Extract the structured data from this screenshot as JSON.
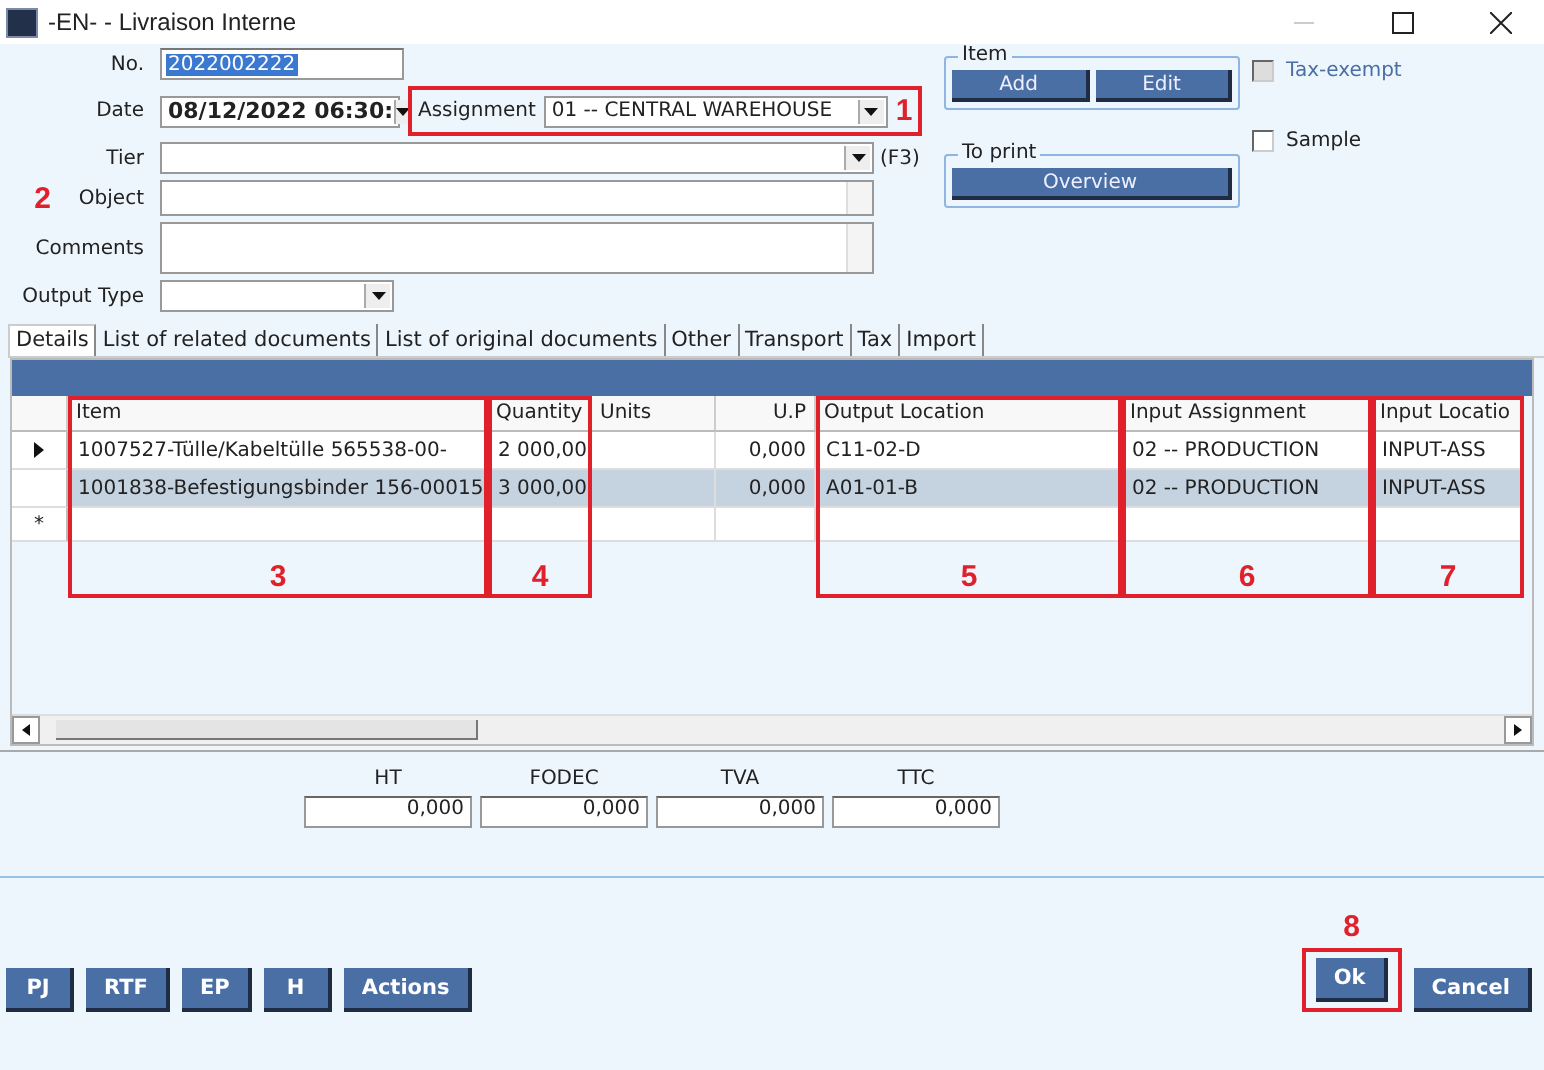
{
  "window": {
    "title": "-EN- - Livraison Interne"
  },
  "form": {
    "no": {
      "label": "No.",
      "value": "2022002222"
    },
    "date": {
      "label": "Date",
      "value": "08/12/2022 06:30:"
    },
    "assignment": {
      "label": "Assignment",
      "value": "01 -- CENTRAL WAREHOUSE",
      "callout": "1"
    },
    "tier": {
      "label": "Tier",
      "hint": "(F3)"
    },
    "object": {
      "label": "Object",
      "callout": "2"
    },
    "comments": {
      "label": "Comments"
    },
    "output_type": {
      "label": "Output Type"
    }
  },
  "item_group": {
    "title": "Item",
    "buttons": [
      "Add",
      "Edit"
    ]
  },
  "print_group": {
    "title": "To print",
    "buttons": [
      "Overview"
    ]
  },
  "checkboxes": [
    {
      "label": "Tax-exempt",
      "checked": false,
      "disabled": true
    },
    {
      "label": "Sample",
      "checked": false,
      "disabled": false
    }
  ],
  "tabs": [
    {
      "label": "Details",
      "selected": true
    },
    {
      "label": "List of related documents",
      "selected": false
    },
    {
      "label": "List of original documents",
      "selected": false
    },
    {
      "label": "Other",
      "selected": false
    },
    {
      "label": "Transport",
      "selected": false
    },
    {
      "label": "Tax",
      "selected": false
    },
    {
      "label": "Import",
      "selected": false
    }
  ],
  "grid": {
    "columns": [
      {
        "label": "Item",
        "callout": "3"
      },
      {
        "label": "Quantity",
        "callout": "4"
      },
      {
        "label": "Units"
      },
      {
        "label": "U.P"
      },
      {
        "label": "Output Location",
        "callout": "5"
      },
      {
        "label": "Input Assignment",
        "callout": "6"
      },
      {
        "label": "Input Locatio",
        "callout": "7"
      }
    ],
    "rows": [
      {
        "current": true,
        "selected": false,
        "item": "1007527-Tülle/Kabeltülle 565538-00-",
        "quantity": "2 000,00",
        "unit_price": "0,000",
        "output_location": "C11-02-D",
        "input_assignment": "02 -- PRODUCTION",
        "input_location": "INPUT-ASS"
      },
      {
        "current": false,
        "selected": true,
        "item": "1001838-Befestigungsbinder 156-00015",
        "quantity": "3 000,00",
        "unit_price": "0,000",
        "output_location": "A01-01-B",
        "input_assignment": "02 -- PRODUCTION",
        "input_location": "INPUT-ASS"
      }
    ],
    "new_row_marker": "*"
  },
  "totals": [
    {
      "label": "HT",
      "value": "0,000"
    },
    {
      "label": "FODEC",
      "value": "0,000"
    },
    {
      "label": "TVA",
      "value": "0,000"
    },
    {
      "label": "TTC",
      "value": "0,000"
    }
  ],
  "footer": {
    "left_buttons": [
      {
        "label": "PJ"
      },
      {
        "label": "RTF"
      },
      {
        "label": "EP"
      },
      {
        "label": "H"
      },
      {
        "label": "Actions"
      }
    ],
    "right_buttons": [
      {
        "label": "Ok",
        "callout": "8"
      },
      {
        "label": "Cancel"
      }
    ]
  }
}
